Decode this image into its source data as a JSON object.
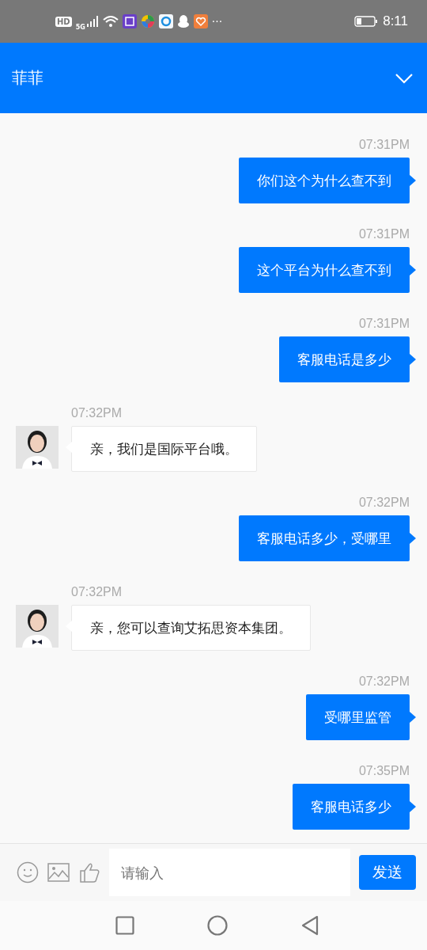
{
  "status_bar": {
    "hd": "HD",
    "network": "5G",
    "more": "···",
    "time": "8:11"
  },
  "header": {
    "title": "菲菲"
  },
  "messages": [
    {
      "kind": "outgoing",
      "time": "07:31PM",
      "text": "你们这个为什么查不到"
    },
    {
      "kind": "outgoing",
      "time": "07:31PM",
      "text": "这个平台为什么查不到"
    },
    {
      "kind": "outgoing",
      "time": "07:31PM",
      "text": "客服电话是多少"
    },
    {
      "kind": "incoming",
      "time": "07:32PM",
      "text": "亲，我们是国际平台哦。"
    },
    {
      "kind": "outgoing",
      "time": "07:32PM",
      "text": "客服电话多少，受哪里"
    },
    {
      "kind": "incoming",
      "time": "07:32PM",
      "text": "亲，您可以查询艾拓思资本集团。"
    },
    {
      "kind": "outgoing",
      "time": "07:32PM",
      "text": "受哪里监管"
    },
    {
      "kind": "outgoing",
      "time": "07:35PM",
      "text": "客服电话多少"
    }
  ],
  "input": {
    "placeholder": "请输入",
    "send": "发送"
  }
}
